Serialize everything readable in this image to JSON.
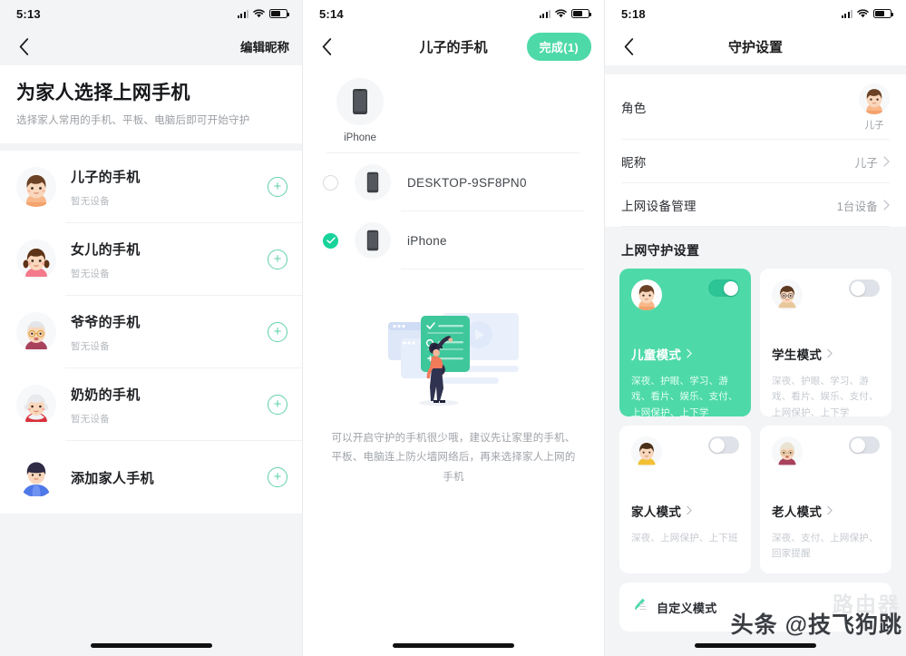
{
  "colors": {
    "accent_green": "#4ed9a9",
    "accent_green_dark": "#2cc395",
    "plus_green": "#5fcfae",
    "page_bg": "#f2f4f6",
    "text_primary": "#1f2124",
    "text_muted": "#9a9ea3"
  },
  "panel1": {
    "status": {
      "time": "5:13",
      "signal": "signal-icon",
      "wifi": "wifi-icon",
      "battery": "battery-icon"
    },
    "nav": {
      "back": "chevron-left-icon",
      "right_action": "编辑昵称"
    },
    "title": "为家人选择上网手机",
    "subtitle": "选择家人常用的手机、平板、电脑后即可开始守护",
    "rows": [
      {
        "name": "儿子的手机",
        "meta": "暂无设备",
        "avatar": "boy-avatar",
        "action": "plus-circle-icon"
      },
      {
        "name": "女儿的手机",
        "meta": "暂无设备",
        "avatar": "girl-avatar",
        "action": "plus-circle-icon"
      },
      {
        "name": "爷爷的手机",
        "meta": "暂无设备",
        "avatar": "grandpa-avatar",
        "action": "plus-circle-icon"
      },
      {
        "name": "奶奶的手机",
        "meta": "暂无设备",
        "avatar": "grandma-avatar",
        "action": "plus-circle-icon"
      },
      {
        "name": "添加家人手机",
        "meta": "",
        "avatar": "man-avatar",
        "action": "plus-circle-icon"
      }
    ]
  },
  "panel2": {
    "status": {
      "time": "5:14",
      "signal": "signal-icon",
      "wifi": "wifi-icon",
      "battery": "battery-icon"
    },
    "nav": {
      "back": "chevron-left-icon",
      "title": "儿子的手机",
      "done_label": "完成(1)"
    },
    "current_device": {
      "label": "iPhone",
      "icon": "phone-icon"
    },
    "devices": [
      {
        "name": "DESKTOP-9SF8PN0",
        "selected": false,
        "icon": "phone-icon"
      },
      {
        "name": "iPhone",
        "selected": true,
        "icon": "phone-icon"
      }
    ],
    "illustration": "person-with-checklist-illustration",
    "hint": "可以开启守护的手机很少哦，建议先让家里的手机、平板、电脑连上防火墙网络后，再来选择家人上网的手机"
  },
  "panel3": {
    "status": {
      "time": "5:18",
      "signal": "signal-icon",
      "wifi": "wifi-icon",
      "battery": "battery-icon"
    },
    "nav": {
      "back": "chevron-left-icon",
      "title": "守护设置"
    },
    "rows": [
      {
        "label": "角色",
        "value": "儿子",
        "avatar": "boy-avatar",
        "type": "avatar"
      },
      {
        "label": "昵称",
        "value": "儿子",
        "type": "link"
      },
      {
        "label": "上网设备管理",
        "value": "1台设备",
        "type": "link"
      }
    ],
    "section_title": "上网守护设置",
    "modes": [
      {
        "name": "儿童模式",
        "avatar": "boy-avatar",
        "enabled": true,
        "tags": "深夜、护眼、学习、游戏、看片、娱乐、支付、上网保护、上下学"
      },
      {
        "name": "学生模式",
        "avatar": "student-avatar",
        "enabled": false,
        "tags": "深夜、护眼、学习、游戏、看片、娱乐、支付、上网保护、上下学"
      },
      {
        "name": "家人模式",
        "avatar": "man-avatar",
        "enabled": false,
        "tags": "深夜、上网保护、上下班"
      },
      {
        "name": "老人模式",
        "avatar": "grandma-avatar",
        "enabled": false,
        "tags": "深夜、支付、上网保护、回家提醒"
      }
    ],
    "custom_mode": {
      "label": "自定义模式",
      "icon": "pencil-edit-icon"
    },
    "watermark": {
      "main": "头条 @技飞狗跳",
      "faint": "路由器"
    }
  }
}
